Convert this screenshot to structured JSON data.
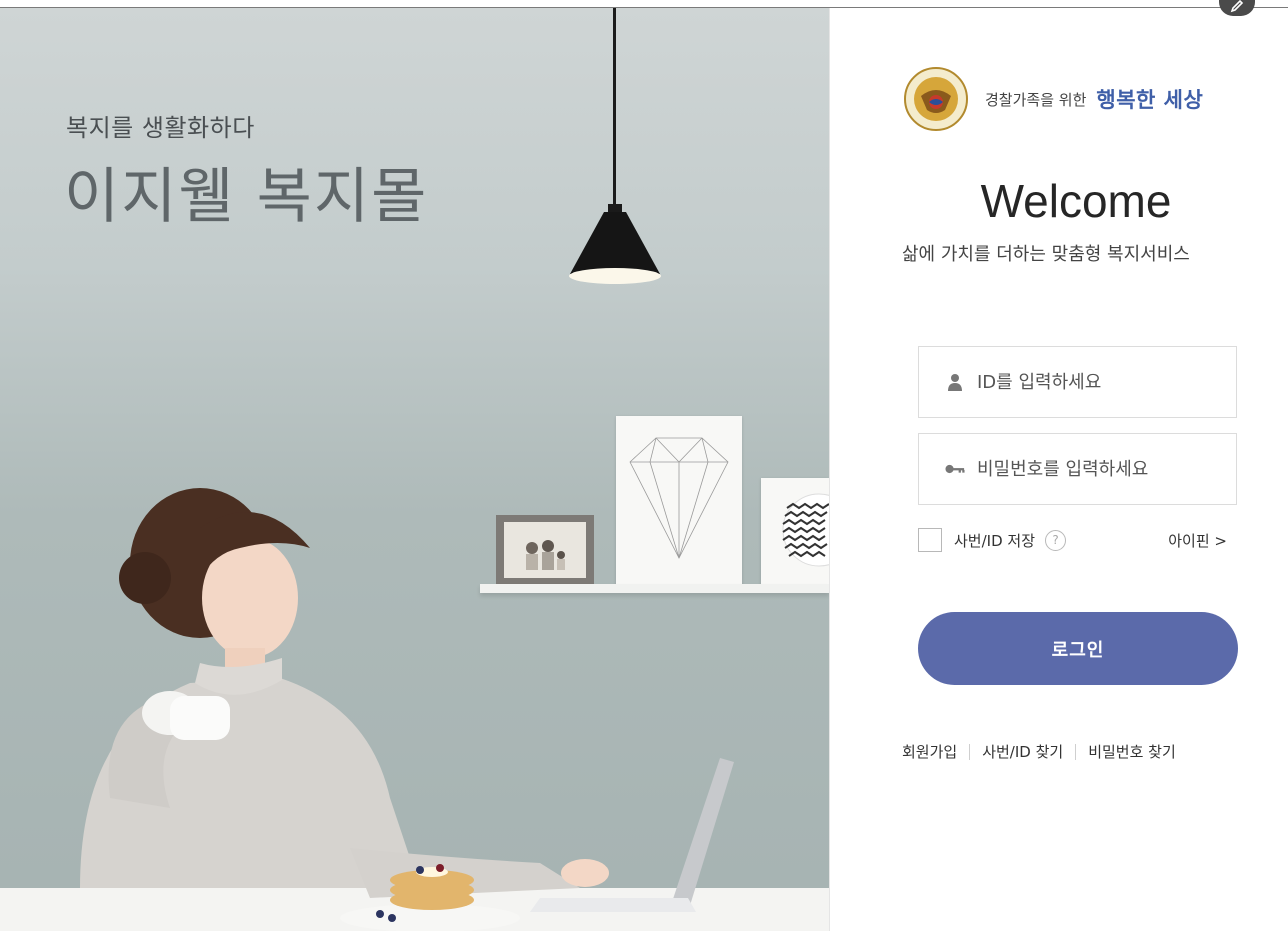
{
  "hero": {
    "subtitle": "복지를 생활화하다",
    "title": "이지웰 복지몰"
  },
  "brand": {
    "slogan_small": "경찰가족을 위한",
    "slogan_big": "행복한 세상",
    "accent_color": "#3f5fa8"
  },
  "login": {
    "welcome": "Welcome",
    "welcome_sub": "삶에 가치를 더하는 맞춤형 복지서비스",
    "id_placeholder": "ID를 입력하세요",
    "pw_placeholder": "비밀번호를 입력하세요",
    "save_label": "사번/ID 저장",
    "help_icon": "?",
    "ipin_label": "아이핀 >",
    "button_label": "로그인",
    "button_color": "#5b6aaa"
  },
  "links": {
    "signup": "회원가입",
    "find_id": "사번/ID 찾기",
    "find_pw": "비밀번호 찾기"
  },
  "icons": {
    "id_field": "user-icon",
    "pw_field": "key-icon",
    "corner": "pencil-icon"
  }
}
